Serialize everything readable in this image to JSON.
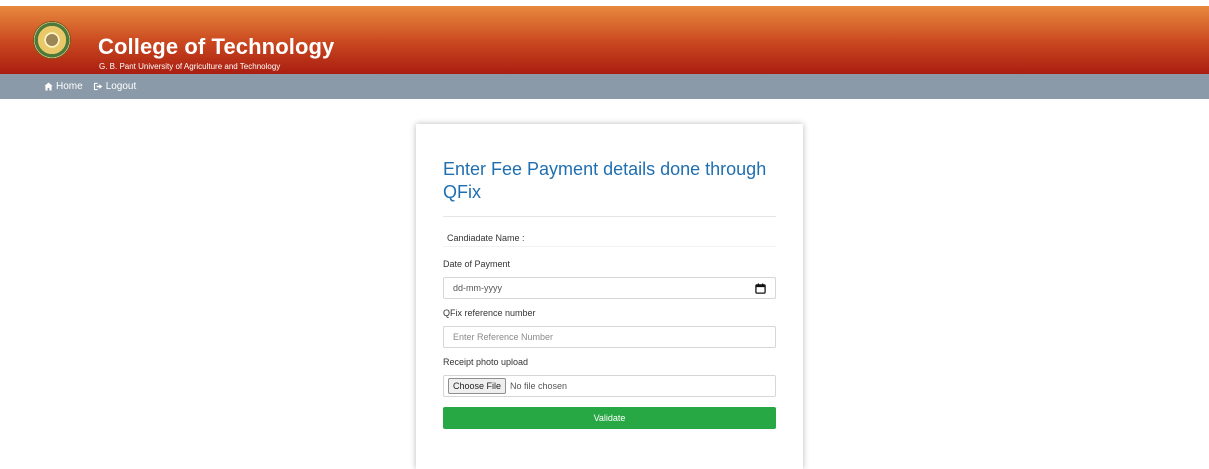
{
  "header": {
    "title": "College of Technology",
    "subtitle": "G. B. Pant University of Agriculture and Technology",
    "gradient_top": "#e8893e",
    "gradient_bottom": "#a91e10"
  },
  "nav": {
    "items": [
      {
        "label": "Home",
        "icon": "home-icon"
      },
      {
        "label": "Logout",
        "icon": "logout-icon"
      }
    ],
    "background": "#8a9aa8"
  },
  "form": {
    "title": "Enter Fee Payment details done through QFix",
    "candidate_label": "Candiadate Name :",
    "date_label": "Date of Payment",
    "date_placeholder": "dd-mm-yyyy",
    "ref_label": "QFix reference number",
    "ref_placeholder": "Enter Reference Number",
    "upload_label": "Receipt photo upload",
    "choose_file_label": "Choose File",
    "no_file_text": "No file chosen",
    "validate_label": "Validate",
    "title_color": "#1f6fb0",
    "button_color": "#28a745"
  }
}
